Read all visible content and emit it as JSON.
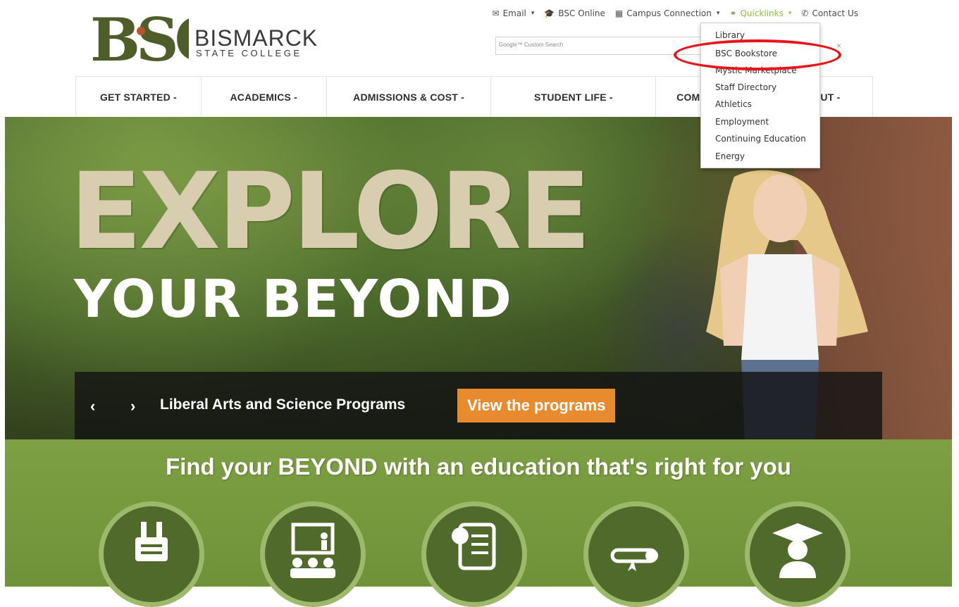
{
  "logo": {
    "name": "BISMARCK",
    "sub": "STATE COLLEGE",
    "mark": "BSC"
  },
  "utility": [
    {
      "label": "Email",
      "icon": "envelope-icon",
      "caret": true
    },
    {
      "label": "BSC Online",
      "icon": "graduation-cap-icon",
      "caret": false
    },
    {
      "label": "Campus Connection",
      "icon": "grid-icon",
      "caret": true
    },
    {
      "label": "Quicklinks",
      "icon": "link-icon",
      "caret": true,
      "active": true
    },
    {
      "label": "Contact Us",
      "icon": "phone-icon",
      "caret": false
    }
  ],
  "search": {
    "placeholder": "Google™ Custom Search",
    "clear": "×"
  },
  "nav": [
    {
      "label": "GET STARTED",
      "caret": "-"
    },
    {
      "label": "ACADEMICS",
      "caret": "-"
    },
    {
      "label": "ADMISSIONS & COST",
      "caret": "-"
    },
    {
      "label": "STUDENT LIFE",
      "caret": "-"
    },
    {
      "label": "COMMUNITY",
      "caret": "-"
    },
    {
      "label": "ABOUT",
      "caret": "-"
    }
  ],
  "quicklinks": [
    "Library",
    "BSC Bookstore",
    "Mystic Marketplace",
    "Staff Directory",
    "Athletics",
    "Employment",
    "Continuing Education",
    "Energy"
  ],
  "hero": {
    "headline": "EXPLORE",
    "subheadline": "YOUR BEYOND",
    "caption": "Liberal Arts and Science Programs",
    "cta": "View the programs",
    "prev": "‹",
    "next": "›"
  },
  "band": {
    "title": "Find your BEYOND with an education that's right for you",
    "icons": [
      "plug-icon",
      "classroom-icon",
      "certificate-scroll-icon",
      "diploma-icon",
      "graduate-icon"
    ]
  },
  "colors": {
    "accent_green": "#7ea043",
    "orange": "#e88a2e",
    "highlight_red": "#e8141c",
    "link_active": "#8fbf3c"
  }
}
